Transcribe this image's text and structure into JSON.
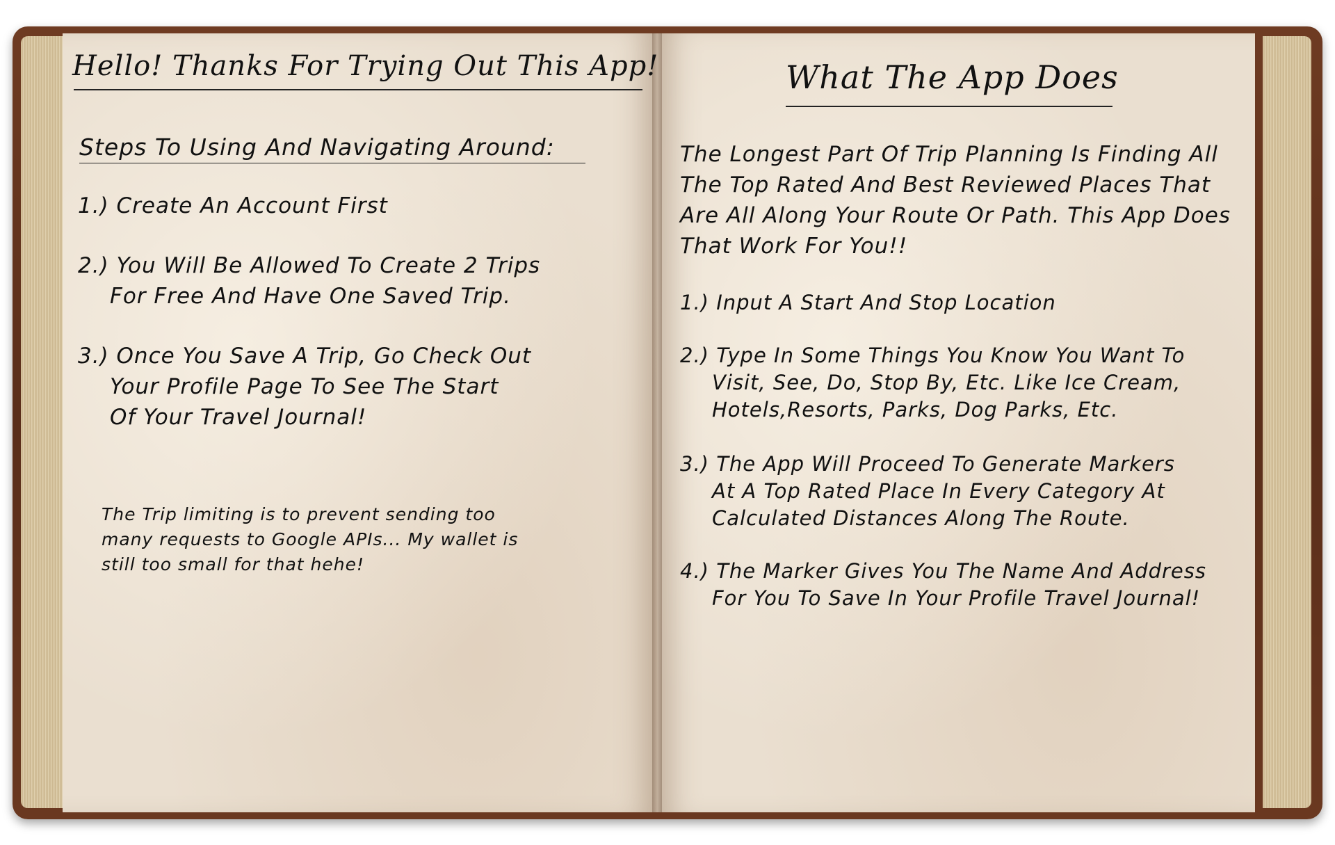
{
  "left_page": {
    "title": "Hello! Thanks For Trying Out This App!",
    "steps_heading": "Steps To Using And Navigating Around:",
    "steps": [
      {
        "num": "1.)",
        "text": "Create An Account First"
      },
      {
        "num": "2.)",
        "line1": "You Will Be Allowed To Create 2 Trips",
        "line2": "For Free And Have One Saved Trip."
      },
      {
        "num": "3.)",
        "line1": "Once You Save A Trip, Go Check Out",
        "line2": "Your Profile Page To See The Start",
        "line3": "Of Your Travel Journal!"
      }
    ],
    "footnote": "The Trip limiting is to prevent sending too many requests to Google APIs... My wallet is still too small for that hehe!"
  },
  "right_page": {
    "title": "What The App Does",
    "intro": "The Longest Part Of Trip Planning Is Finding All The Top Rated And Best Reviewed Places That Are All Along Your Route Or Path. This App Does That Work For You!!",
    "steps": [
      {
        "num": "1.)",
        "text": "Input A Start And Stop Location"
      },
      {
        "num": "2.)",
        "line1": "Type In Some Things You Know You Want To",
        "line2": "Visit, See, Do, Stop By, Etc. Like Ice Cream,",
        "line3": "Hotels,Resorts, Parks, Dog Parks, Etc."
      },
      {
        "num": "3.)",
        "line1": "The App Will Proceed To Generate Markers",
        "line2": "At A Top Rated Place In Every Category At",
        "line3": "Calculated Distances Along The Route."
      },
      {
        "num": "4.)",
        "line1": "The Marker Gives You The Name And Address",
        "line2": "For You To Save In Your Profile Travel Journal!"
      }
    ]
  },
  "colors": {
    "cover": "#5a2e1a",
    "paper": "#eadfd0",
    "ink": "#111111"
  }
}
